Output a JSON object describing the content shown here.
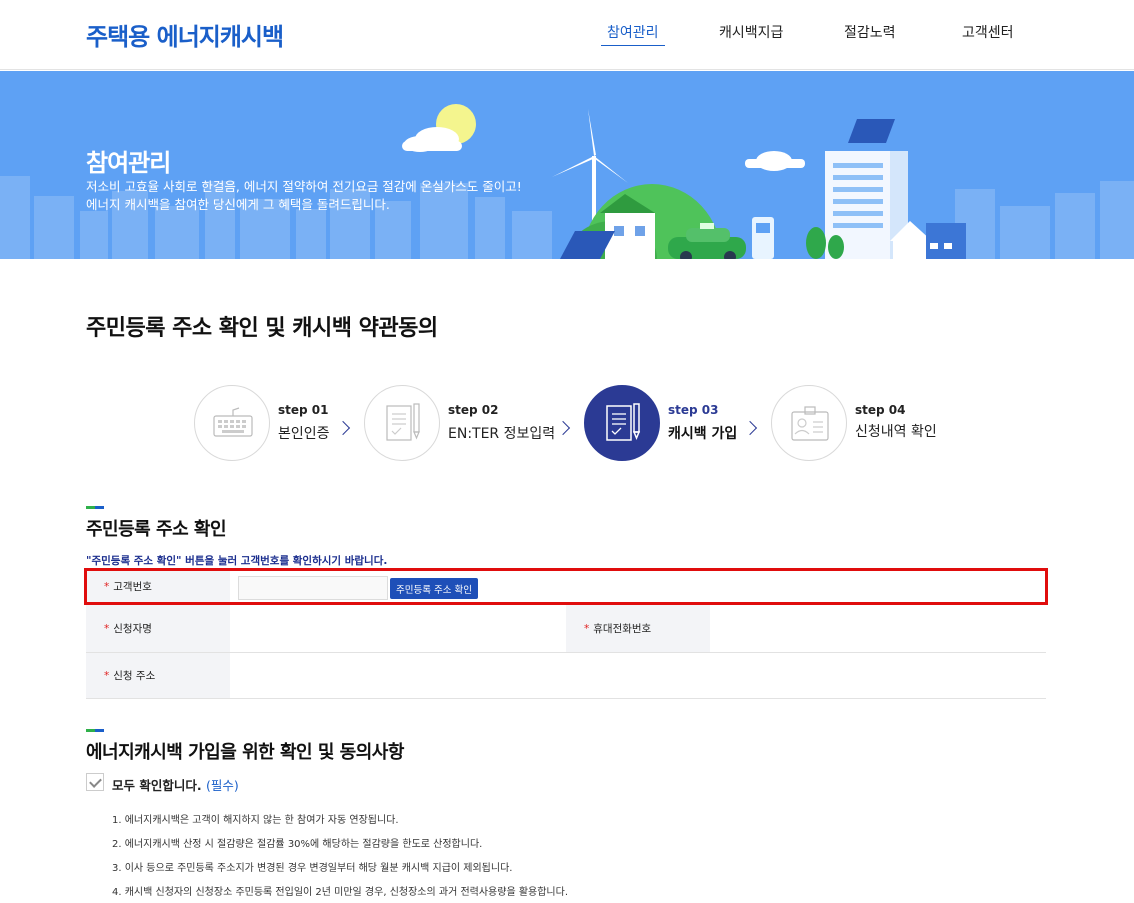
{
  "header": {
    "logo_main": "주택용",
    "logo_sub": "에너지캐시백",
    "nav": [
      {
        "label": "참여관리",
        "active": true
      },
      {
        "label": "캐시백지급",
        "active": false
      },
      {
        "label": "절감노력",
        "active": false
      },
      {
        "label": "고객센터",
        "active": false
      }
    ]
  },
  "hero": {
    "title": "참여관리",
    "desc_line1": "저소비 고효율 사회로 한걸음, 에너지 절약하여 전기요금 절감에 온실가스도 줄이고!",
    "desc_line2": "에너지 캐시백을 참여한 당신에게 그 혜택을 돌려드립니다."
  },
  "page_title": "주민등록 주소 확인 및 캐시백 약관동의",
  "steps": [
    {
      "num": "step 01",
      "label": "본인인증",
      "icon": "keyboard-icon",
      "active": false
    },
    {
      "num": "step 02",
      "label": "EN:TER 정보입력",
      "icon": "document-pen-icon",
      "active": false
    },
    {
      "num": "step 03",
      "label": "캐시백 가입",
      "icon": "document-pen-icon",
      "active": true
    },
    {
      "num": "step 04",
      "label": "신청내역 확인",
      "icon": "id-card-icon",
      "active": false
    }
  ],
  "section1": {
    "title": "주민등록 주소 확인",
    "notice": "\"주민등록 주소 확인\" 버튼을 눌러 고객번호를 확인하시기 바랍니다."
  },
  "form": {
    "req_mark": "*",
    "customer_no_label": "고객번호",
    "customer_no_value": "",
    "confirm_button": "주민등록 주소 확인",
    "applicant_label": "신청자명",
    "phone_label": "휴대전화번호",
    "address_label": "신청 주소"
  },
  "section2": {
    "title": "에너지캐시백 가입을 위한 확인 및 동의사항",
    "agree_all": "모두 확인합니다.",
    "agree_required": "(필수)",
    "terms": [
      "1. 에너지캐시백은 고객이 해지하지 않는 한 참여가 자동 연장됩니다.",
      "2. 에너지캐시백 산정 시 절감량은 절감률 30%에 해당하는 절감량을 한도로 산정합니다.",
      "3. 이사 등으로 주민등록 주소지가 변경된 경우 변경일부터 해당 월분 캐시백 지급이 제외됩니다.",
      "4. 캐시백 신청자의 신청장소 주민등록 전입일이 2년 미만일 경우, 신청장소의 과거 전력사용량을 활용합니다."
    ]
  },
  "colors": {
    "brand": "#1a5fc9",
    "step_active": "#2b3a94",
    "highlight": "#e00d0d",
    "hero_bg": "#5ea1f4"
  }
}
